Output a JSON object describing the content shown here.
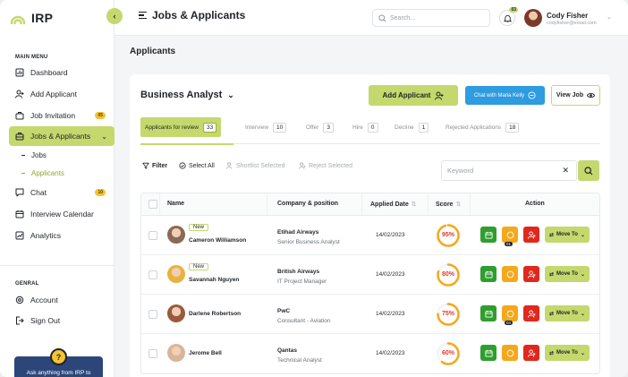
{
  "app": {
    "logo_text": "IRP"
  },
  "sidebar": {
    "main_menu_label": "MAIN MENU",
    "items": [
      {
        "label": "Dashboard",
        "icon": "dashboard-icon"
      },
      {
        "label": "Add Applicant",
        "icon": "add-user-icon"
      },
      {
        "label": "Job Invitation",
        "icon": "briefcase-icon",
        "badge": "05"
      },
      {
        "label": "Jobs & Applicants",
        "icon": "jobs-icon",
        "active": true
      },
      {
        "label": "Chat",
        "icon": "chat-icon",
        "badge": "10"
      },
      {
        "label": "Interview Calendar",
        "icon": "calendar-icon"
      },
      {
        "label": "Analytics",
        "icon": "analytics-icon"
      }
    ],
    "sub_items": [
      {
        "label": "Jobs"
      },
      {
        "label": "Applicants",
        "active": true
      }
    ],
    "general_label": "GENRAL",
    "general_items": [
      {
        "label": "Account",
        "icon": "account-icon"
      },
      {
        "label": "Sign Out",
        "icon": "signout-icon"
      }
    ],
    "help_text": "Ask anything from IRP to"
  },
  "header": {
    "title": "Jobs & Applicants",
    "search_placeholder": "Search...",
    "notifications_count": "03",
    "user_name": "Cody Fisher",
    "user_email": "codyfisher@email.com"
  },
  "page": {
    "title": "Applicants",
    "role": "Business Analyst",
    "add_applicant_label": "Add Applicant",
    "chat_label": "Chat with Maria Kelly",
    "view_job_label": "View Job"
  },
  "tabs": [
    {
      "label": "Applicants for review",
      "count": "33",
      "active": true
    },
    {
      "label": "Interview",
      "count": "10"
    },
    {
      "label": "Offer",
      "count": "3"
    },
    {
      "label": "Hire",
      "count": "0"
    },
    {
      "label": "Decline",
      "count": "1"
    },
    {
      "label": "Rejected Applications",
      "count": "18"
    }
  ],
  "toolbar": {
    "filter_label": "Filter",
    "select_all_label": "Select All",
    "shortlist_label": "Shortlist Selected",
    "reject_label": "Reject Selected",
    "keyword_placeholder": "Keyword"
  },
  "table": {
    "headers": {
      "name": "Name",
      "company": "Company & position",
      "applied": "Applied Date",
      "score": "Score",
      "action": "Action"
    },
    "move_to_label": "Move To",
    "rows": [
      {
        "name": "Cameron Williamson",
        "new": "New",
        "company": "Etihad Airways",
        "position": "Senior Business Analyst",
        "date": "14/02/2023",
        "score": "95%",
        "score_value": 95,
        "badge": "01",
        "avatar_color": "#8a6a55"
      },
      {
        "name": "Savannah Nguyen",
        "new": "New",
        "company": "British Airways",
        "position": "IT Project Manager",
        "date": "14/02/2023",
        "score": "80%",
        "score_value": 80,
        "badge": "",
        "avatar_color": "#e8b23c"
      },
      {
        "name": "Darlene Robertson",
        "new": "",
        "company": "PwC",
        "position": "Consultant - Aviation",
        "date": "14/02/2023",
        "score": "75%",
        "score_value": 75,
        "badge": "04",
        "avatar_color": "#9c5a3c"
      },
      {
        "name": "Jerome Bell",
        "new": "",
        "company": "Qantas",
        "position": "Technical Analyst",
        "date": "14/02/2023",
        "score": "60%",
        "score_value": 60,
        "badge": "",
        "avatar_color": "#d8b59a"
      }
    ]
  },
  "colors": {
    "accent": "#c5d86d",
    "chat_blue": "#2f9be0",
    "score_red": "#e03a2e",
    "score_orange": "#f4a81c",
    "action_green": "#2f9e2f",
    "action_red": "#e0281e"
  }
}
